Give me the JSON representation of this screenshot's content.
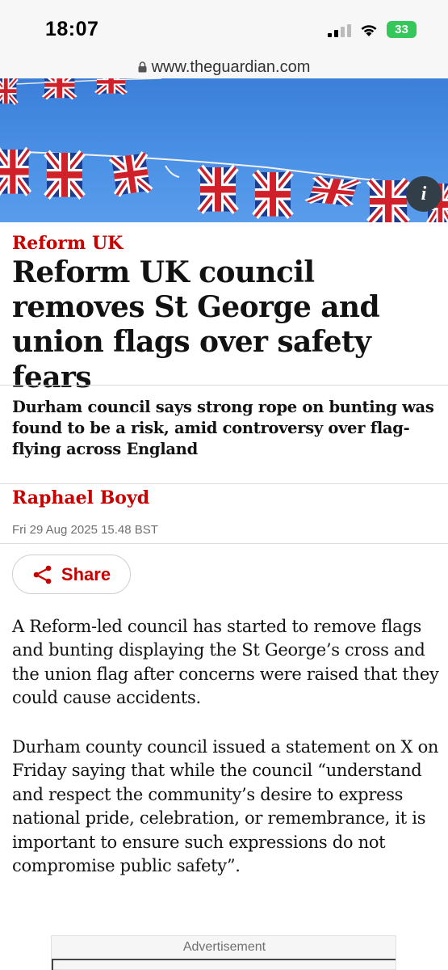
{
  "status_bar": {
    "time": "18:07",
    "battery": "33"
  },
  "browser": {
    "url": "www.theguardian.com"
  },
  "hero": {
    "caption_icon": "info-icon",
    "info_label": "i"
  },
  "article": {
    "kicker": "Reform UK",
    "headline": "Reform UK council removes St George and union flags over safety fears",
    "standfirst": "Durham council says strong rope on bunting was found to be a risk, amid controversy over flag-flying across England",
    "byline": "Raphael Boyd",
    "dateline": "Fri 29 Aug 2025 15.48 BST",
    "share_label": "Share",
    "paragraphs": [
      "A Reform-led council has started to remove flags and bunting displaying the St George’s cross and the union flag after concerns were raised that they could cause accidents.",
      "Durham county council issued a statement on X on Friday saying that while the council “understand and respect the community’s desire to express national pride, celebration, or remembrance, it is important to ensure such expressions do not compromise public safety”."
    ]
  },
  "advert": {
    "label": "Advertisement"
  },
  "colors": {
    "accent": "#c70000",
    "text": "#121212",
    "muted": "#707070",
    "sky": "#4c92e6"
  }
}
